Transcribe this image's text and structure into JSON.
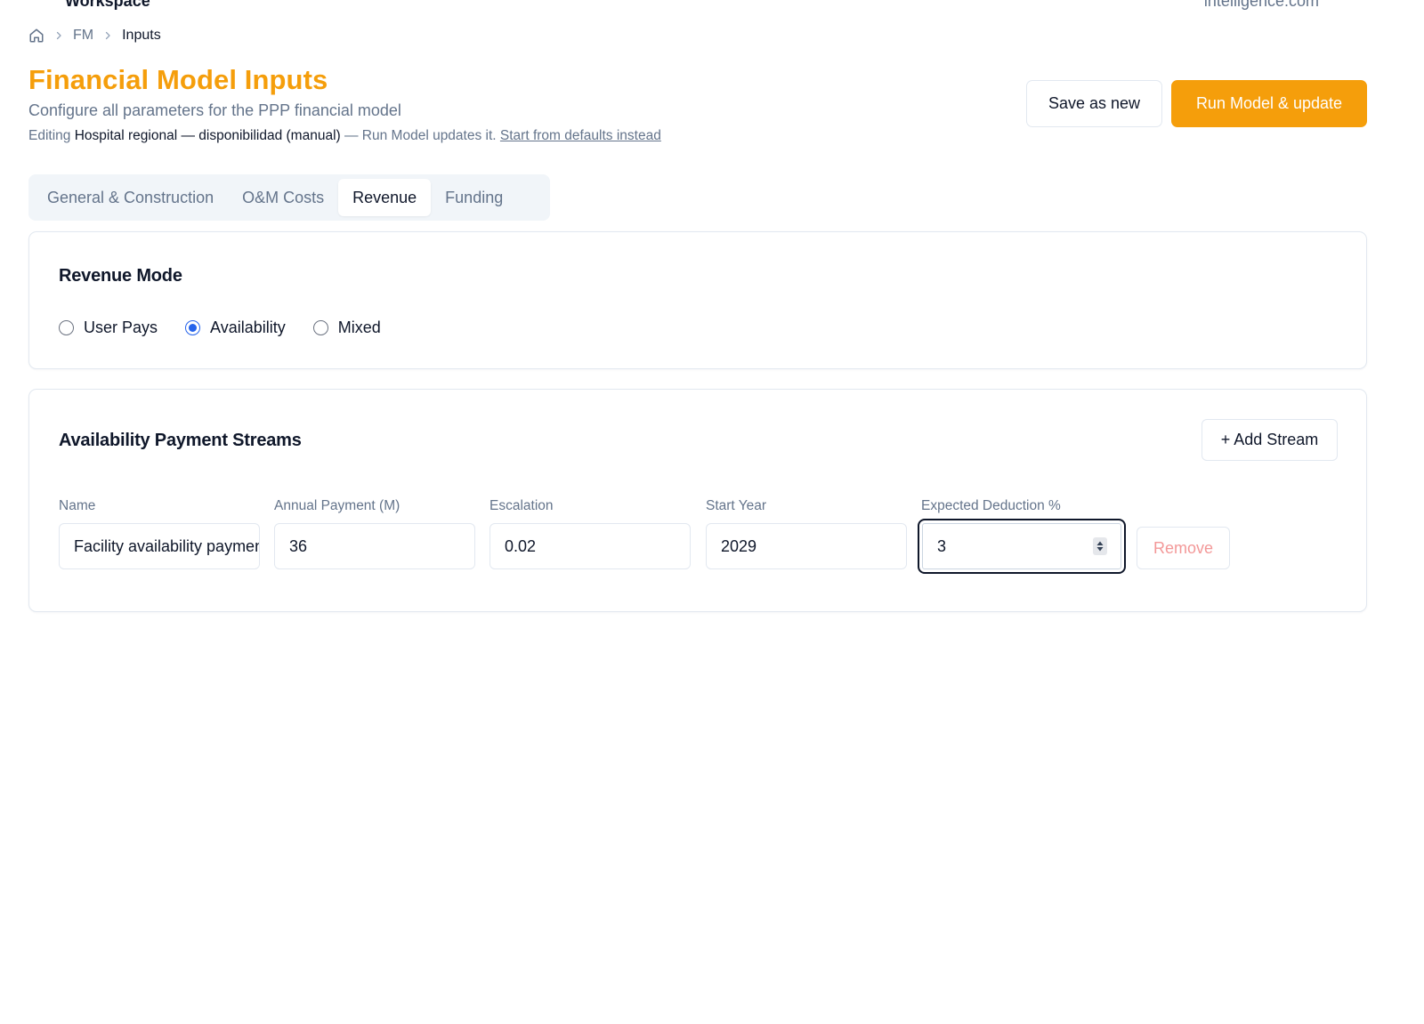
{
  "top": {
    "workspace": "Workspace",
    "email": "intelligence.com"
  },
  "breadcrumb": {
    "items": [
      "FM",
      "Inputs"
    ]
  },
  "header": {
    "title": "Financial Model Inputs",
    "subtitle": "Configure all parameters for the PPP financial model",
    "editing_prefix": "Editing",
    "editing_name": "Hospital regional — disponibilidad (manual)",
    "editing_suffix": "— Run Model updates it.",
    "defaults_link": "Start from defaults instead"
  },
  "actions": {
    "save_label": "Save as new",
    "run_label": "Run Model & update",
    "accent_color": "#f59e0b"
  },
  "tabs": [
    {
      "label": "General & Construction",
      "active": false
    },
    {
      "label": "O&M Costs",
      "active": false
    },
    {
      "label": "Revenue",
      "active": true
    },
    {
      "label": "Funding",
      "active": false
    }
  ],
  "revenue_mode": {
    "title": "Revenue Mode",
    "options": [
      {
        "label": "User Pays",
        "checked": false
      },
      {
        "label": "Availability",
        "checked": true
      },
      {
        "label": "Mixed",
        "checked": false
      }
    ]
  },
  "streams": {
    "title": "Availability Payment Streams",
    "add_label": "+ Add Stream",
    "columns": [
      "Name",
      "Annual Payment (M)",
      "Escalation",
      "Start Year",
      "Expected Deduction %"
    ],
    "rows": [
      {
        "name": "Facility availability payment",
        "annual_payment": "36",
        "escalation": "0.02",
        "start_year": "2029",
        "expected_deduction": "3",
        "remove_label": "Remove"
      }
    ]
  }
}
